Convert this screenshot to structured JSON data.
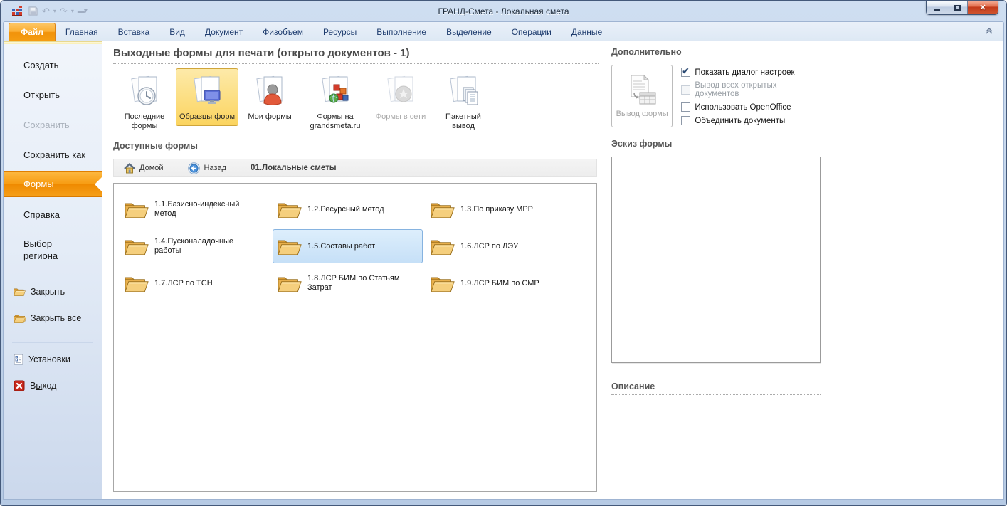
{
  "window": {
    "title": "ГРАНД-Смета - Локальная смета"
  },
  "ribbon": {
    "file_tab": "Файл",
    "tabs": [
      "Главная",
      "Вставка",
      "Вид",
      "Документ",
      "Физобъем",
      "Ресурсы",
      "Выполнение",
      "Выделение",
      "Операции",
      "Данные"
    ]
  },
  "sidebar": {
    "create": "Создать",
    "open": "Открыть",
    "save": "Сохранить",
    "save_as": "Сохранить как",
    "forms": "Формы",
    "help": "Справка",
    "region": "Выбор региона",
    "close": "Закрыть",
    "close_all": "Закрыть все",
    "settings": "Установки",
    "exit_pre": "В",
    "exit_accel": "ы",
    "exit_post": "ход"
  },
  "main": {
    "title": "Выходные формы для печати (открыто документов - 1)",
    "categories": [
      {
        "label": "Последние формы",
        "state": "normal"
      },
      {
        "label": "Образцы форм",
        "state": "selected"
      },
      {
        "label": "Мои формы",
        "state": "normal"
      },
      {
        "label": "Формы на grandsmeta.ru",
        "state": "normal"
      },
      {
        "label": "Формы в сети",
        "state": "disabled"
      },
      {
        "label": "Пакетный вывод",
        "state": "normal"
      }
    ],
    "available_header": "Доступные формы",
    "toolbar": {
      "home": "Домой",
      "back": "Назад",
      "path": "01.Локальные сметы"
    },
    "folders": [
      {
        "label": "1.1.Базисно-индексный метод",
        "selected": false
      },
      {
        "label": "1.2.Ресурсный метод",
        "selected": false
      },
      {
        "label": "1.3.По приказу МРР",
        "selected": false
      },
      {
        "label": "1.4.Пусконаладочные работы",
        "selected": false
      },
      {
        "label": "1.5.Составы работ",
        "selected": true
      },
      {
        "label": "1.6.ЛСР по ЛЭУ",
        "selected": false
      },
      {
        "label": "1.7.ЛСР по ТСН",
        "selected": false
      },
      {
        "label": "1.8.ЛСР БИМ по Статьям Затрат",
        "selected": false
      },
      {
        "label": "1.9.ЛСР БИМ по СМР",
        "selected": false
      }
    ]
  },
  "right": {
    "header": "Дополнительно",
    "output_button": "Вывод формы",
    "checkboxes": [
      {
        "label": "Показать диалог настроек",
        "checked": true,
        "disabled": false
      },
      {
        "label": "Вывод всех открытых документов",
        "checked": false,
        "disabled": true
      },
      {
        "label": "Использовать OpenOffice",
        "checked": false,
        "disabled": false
      },
      {
        "label": "Объединить документы",
        "checked": false,
        "disabled": false
      }
    ],
    "thumbnail_header": "Эскиз формы",
    "description_header": "Описание"
  },
  "colors": {
    "accent_orange": "#f59d12",
    "selection_blue": "#c6e0f7",
    "close_red": "#c23a1b",
    "folder_yellow": "#f2c457"
  }
}
